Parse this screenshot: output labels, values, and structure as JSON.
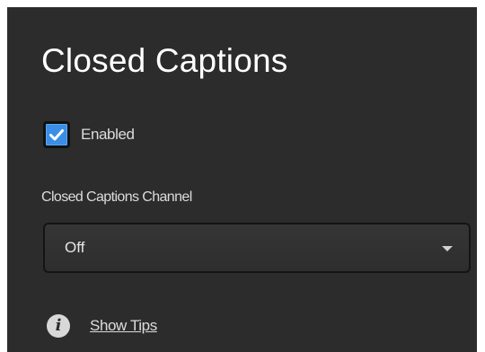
{
  "panel": {
    "title": "Closed Captions",
    "enabled_checkbox": {
      "label": "Enabled",
      "checked": true
    },
    "channel_field": {
      "label": "Closed Captions Channel",
      "selected_value": "Off"
    },
    "tips": {
      "link_label": "Show Tips"
    }
  },
  "colors": {
    "panel_background": "#2c2c2c",
    "checkbox_accent": "#3a8ee6",
    "text": "#dcdcdc"
  },
  "icons": {
    "checkbox": "checkmark-icon",
    "dropdown": "chevron-down-icon",
    "tips": "info-icon"
  }
}
